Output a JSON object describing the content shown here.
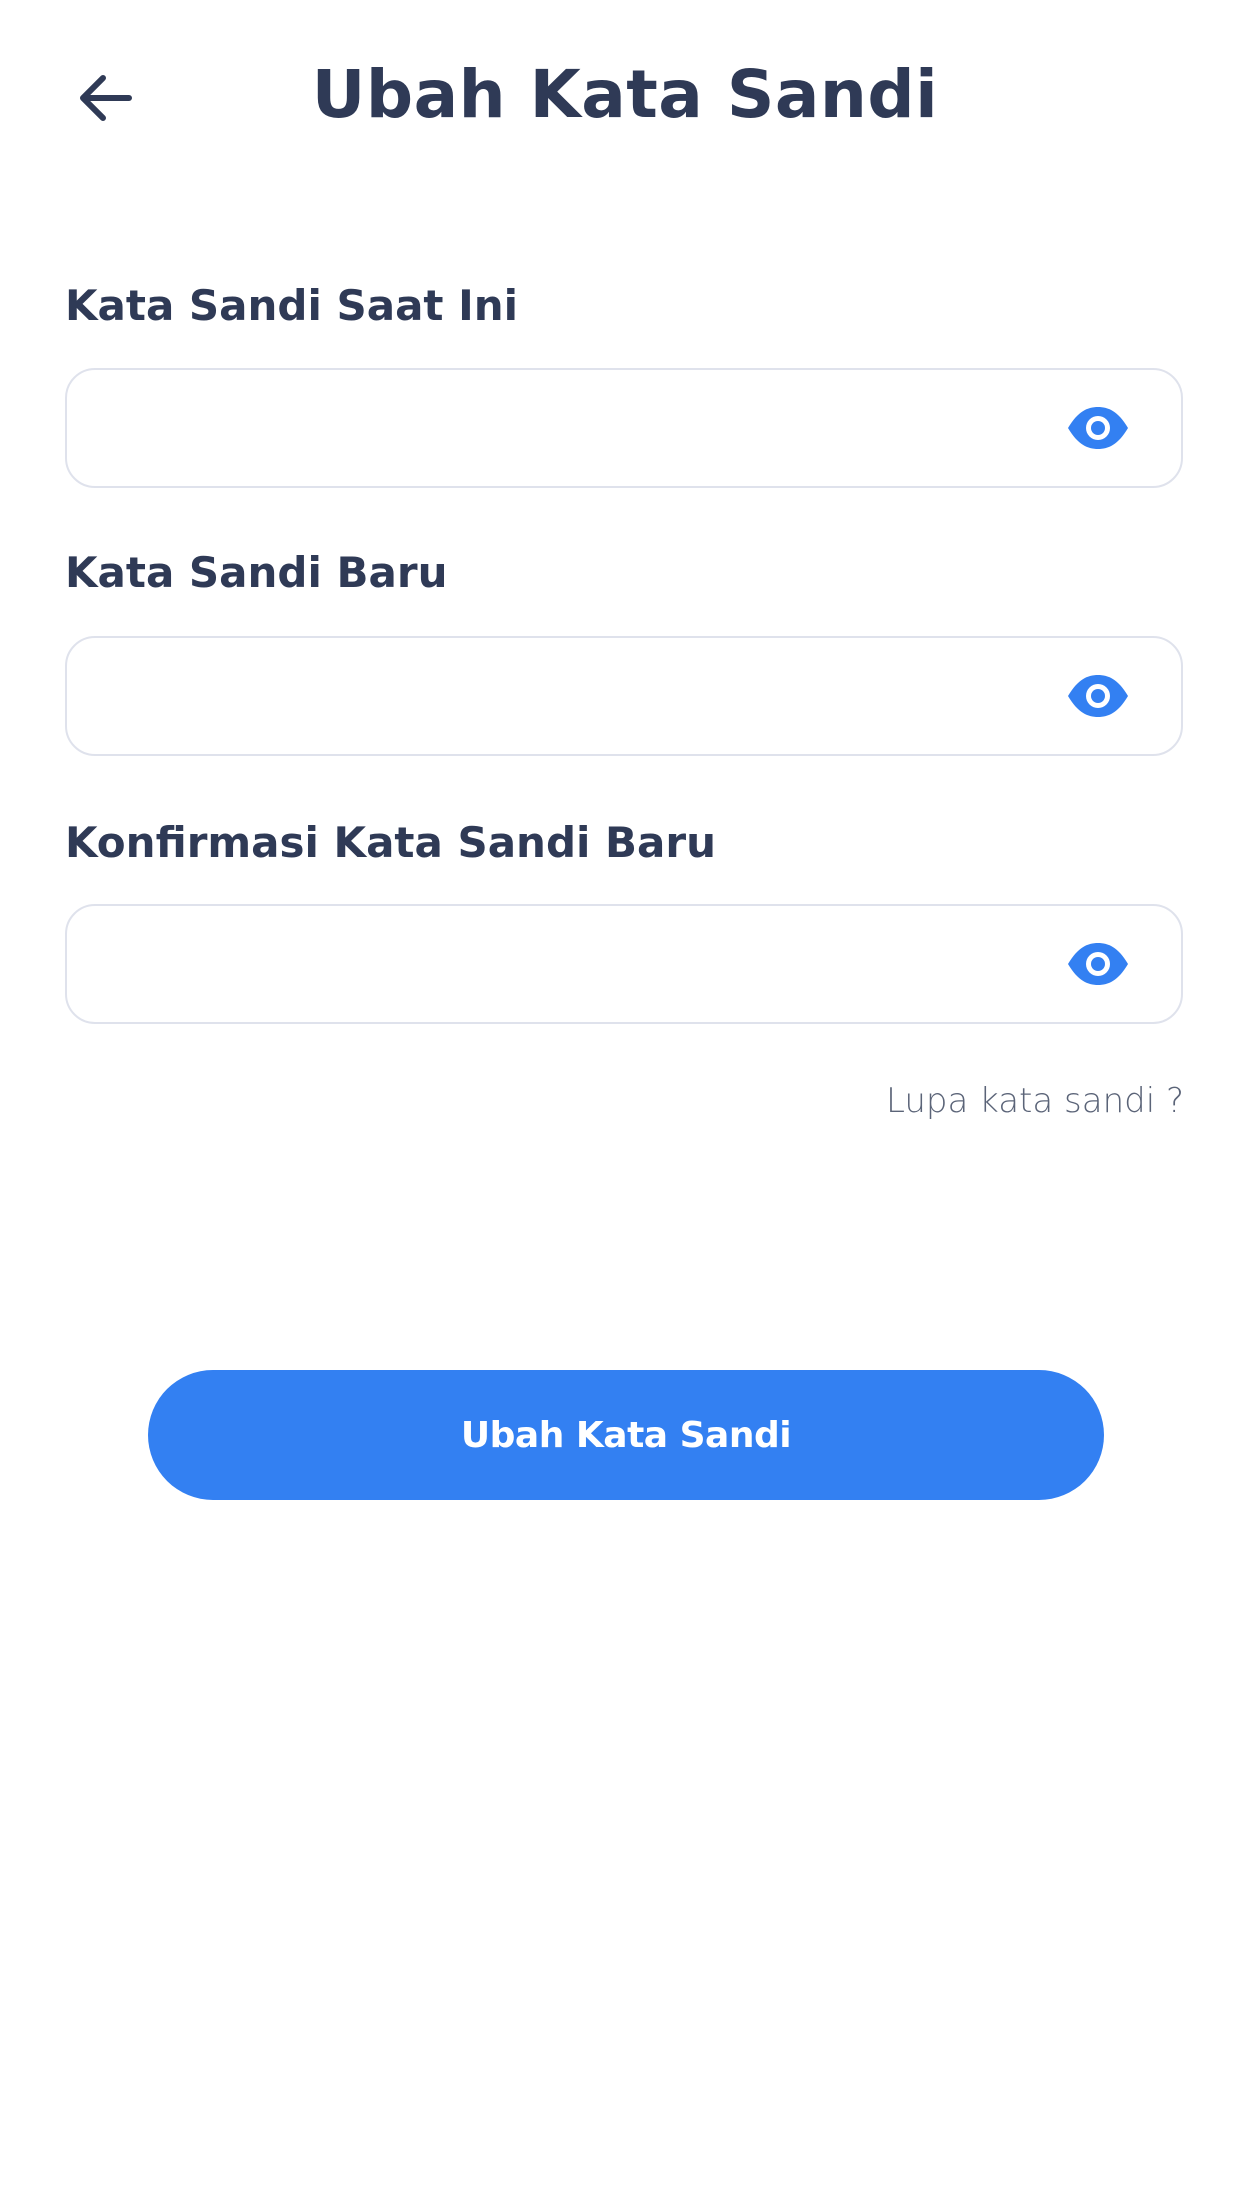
{
  "header": {
    "back_icon": "arrow-left-icon",
    "title": "Ubah Kata Sandi"
  },
  "form": {
    "fields": [
      {
        "label": "Kata Sandi Saat Ini",
        "value": "",
        "placeholder": "",
        "toggle_icon": "eye-icon"
      },
      {
        "label": "Kata Sandi Baru",
        "value": "",
        "placeholder": "",
        "toggle_icon": "eye-icon"
      },
      {
        "label": "Konfirmasi Kata Sandi Baru",
        "value": "",
        "placeholder": "",
        "toggle_icon": "eye-icon"
      }
    ],
    "forgot_label": "Lupa kata sandi ?",
    "submit_label": "Ubah Kata Sandi"
  },
  "colors": {
    "accent": "#3380f2",
    "text": "#2f3a56",
    "border": "#dfe2ec",
    "muted": "#5b6478"
  }
}
